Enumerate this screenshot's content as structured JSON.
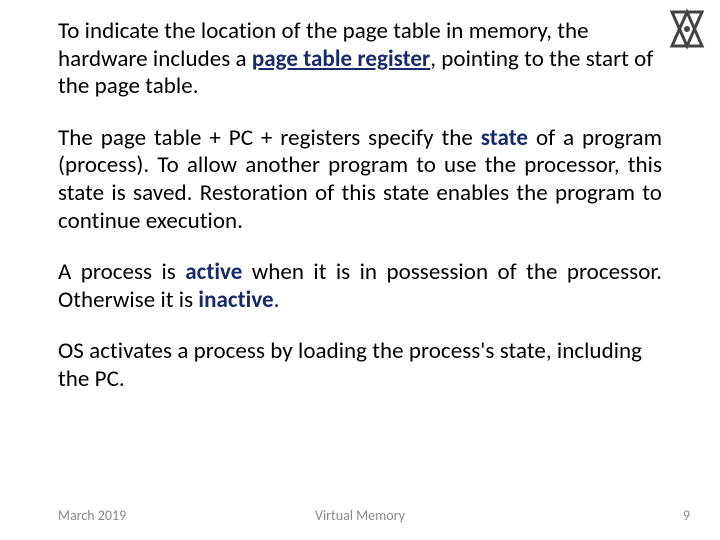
{
  "logo": {
    "name": "technion-logo"
  },
  "paragraphs": {
    "p1_a": "To indicate the location of the page table in memory, the hardware includes a ",
    "p1_emph": "page table register",
    "p1_b": ", pointing to the start of the page table.",
    "p2_a": "The page table + PC + registers specify the ",
    "p2_state": "state",
    "p2_b": " of a program (process). To allow another program to use the processor, this state is saved. Restoration of this state enables the program to continue execution.",
    "p3_a": "A process is ",
    "p3_active": "active",
    "p3_b": " when it is in possession of the processor. Otherwise it is ",
    "p3_inactive": "inactive",
    "p3_c": ".",
    "p4": "OS activates a process by loading the process's state, including the PC."
  },
  "footer": {
    "date": "March 2019",
    "title": "Virtual Memory",
    "page": "9"
  }
}
